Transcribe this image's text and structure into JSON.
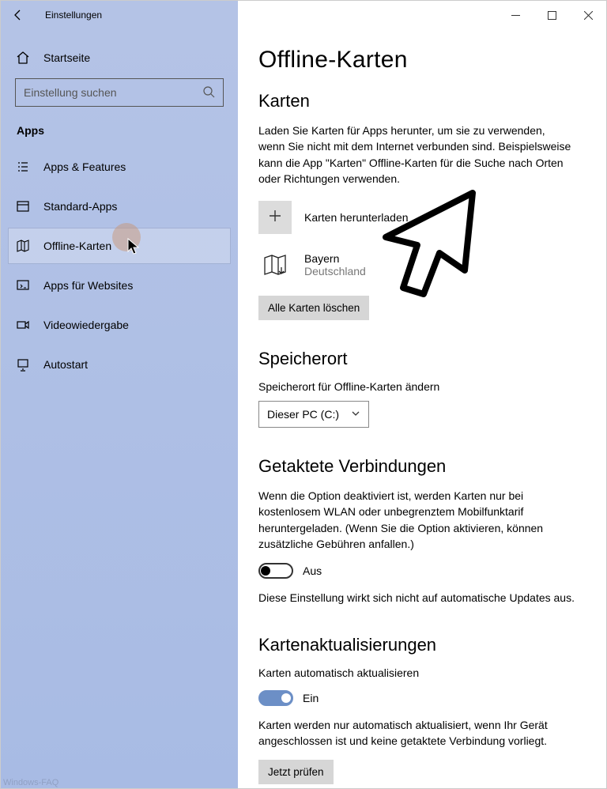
{
  "window": {
    "title": "Einstellungen"
  },
  "sidebar": {
    "home": "Startseite",
    "search_placeholder": "Einstellung suchen",
    "group": "Apps",
    "items": [
      {
        "label": "Apps & Features"
      },
      {
        "label": "Standard-Apps"
      },
      {
        "label": "Offline-Karten"
      },
      {
        "label": "Apps für Websites"
      },
      {
        "label": "Videowiedergabe"
      },
      {
        "label": "Autostart"
      }
    ]
  },
  "page": {
    "title": "Offline-Karten",
    "maps_heading": "Karten",
    "maps_description": "Laden Sie Karten für Apps herunter, um sie zu verwenden, wenn Sie nicht mit dem Internet verbunden sind. Beispielsweise kann die App \"Karten\" Offline-Karten für die Suche nach Orten oder Richtungen verwenden.",
    "download_label": "Karten herunterladen",
    "region_name": "Bayern",
    "region_country": "Deutschland",
    "delete_all": "Alle Karten löschen",
    "storage_heading": "Speicherort",
    "storage_label": "Speicherort für Offline-Karten ändern",
    "storage_value": "Dieser PC (C:)",
    "metered_heading": "Getaktete Verbindungen",
    "metered_desc": "Wenn die Option deaktiviert ist, werden Karten nur bei kostenlosem WLAN oder unbegrenztem Mobilfunktarif heruntergeladen. (Wenn Sie die Option aktivieren, können zusätzliche Gebühren anfallen.)",
    "metered_state": "Aus",
    "metered_note": "Diese Einstellung wirkt sich nicht auf automatische Updates aus.",
    "updates_heading": "Kartenaktualisierungen",
    "updates_label": "Karten automatisch aktualisieren",
    "updates_state": "Ein",
    "updates_note": "Karten werden nur automatisch aktualisiert, wenn Ihr Gerät angeschlossen ist und keine getaktete Verbindung vorliegt.",
    "check_now": "Jetzt prüfen"
  },
  "watermark": "Windows-FAQ"
}
